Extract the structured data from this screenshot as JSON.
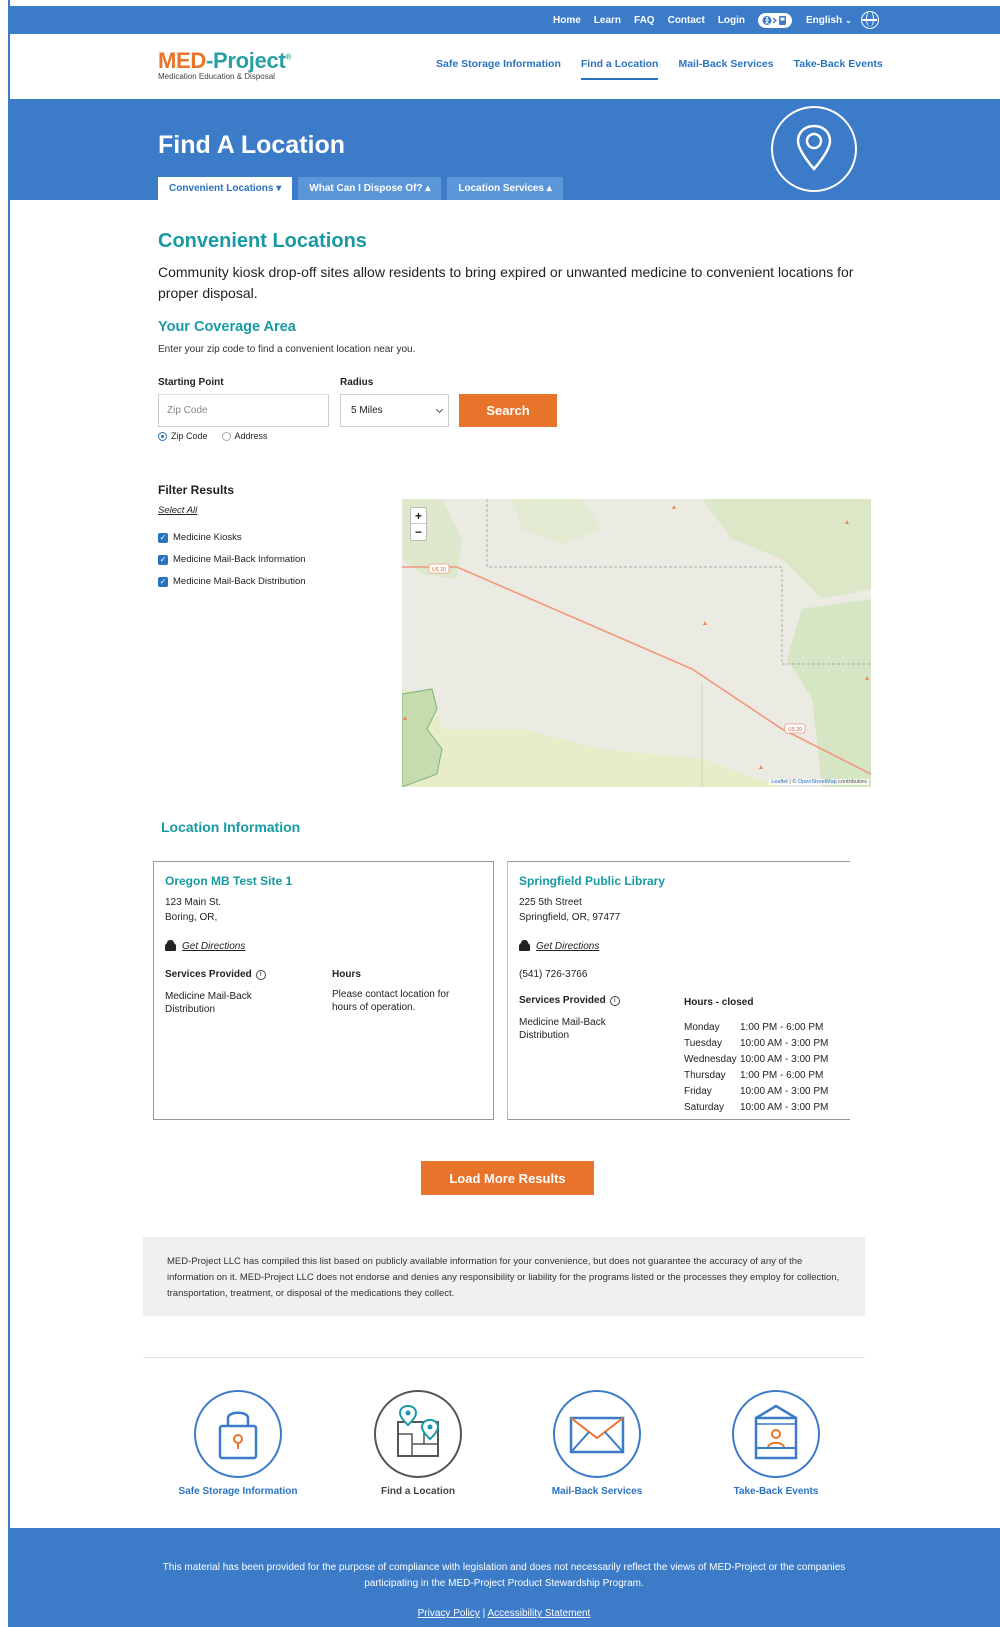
{
  "utility_nav": {
    "items": [
      "Home",
      "Learn",
      "FAQ",
      "Contact",
      "Login"
    ],
    "accessibility_icon": "accessibility-icon",
    "language": "English",
    "globe_icon": "globe-icon"
  },
  "brand": {
    "name_part1": "MED",
    "name_dash": "-",
    "name_part2": "Project",
    "registered": "®",
    "tagline": "Medication Education & Disposal"
  },
  "main_nav": {
    "items": [
      "Safe Storage Information",
      "Find a Location",
      "Mail-Back Services",
      "Take-Back Events"
    ],
    "active": "Find a Location"
  },
  "hero": {
    "title": "Find A Location",
    "tabs": [
      "Convenient Locations ▾",
      "What Can I Dispose Of? ▴",
      "Location Services ▴"
    ]
  },
  "convenient": {
    "title": "Convenient Locations",
    "description": "Community kiosk drop-off sites allow residents to bring expired or unwanted medicine to convenient locations for proper disposal."
  },
  "coverage": {
    "title": "Your Coverage Area",
    "description": "Enter your zip code to find a convenient location near you.",
    "starting_point_label": "Starting Point",
    "radius_label": "Radius",
    "zip_placeholder": "Zip Code",
    "radius_value": "5 Miles",
    "search_label": "Search",
    "radio_zip": "Zip Code",
    "radio_address": "Address",
    "selected_mode": "Zip Code"
  },
  "filters": {
    "title": "Filter Results",
    "select_all": "Select All",
    "options": [
      "Medicine Kiosks",
      "Medicine Mail-Back Information",
      "Medicine Mail-Back Distribution"
    ],
    "checked": [
      true,
      true,
      true
    ]
  },
  "map": {
    "zoom_in": "+",
    "zoom_out": "−",
    "road_label": "US 20",
    "attribution_leaflet": "Leaflet",
    "attribution_sep": " | © ",
    "attribution_osm": "OpenStreetMap",
    "attribution_suffix": " contributors",
    "colors": {
      "land": "#ecebe3",
      "forest": "#d7e6c3",
      "road": "#f2987c",
      "park_border": "#7fb37a"
    }
  },
  "location_info": {
    "title": "Location Information",
    "get_directions": "Get Directions",
    "services_label": "Services Provided",
    "info_icon": "info-icon",
    "car_icon": "car-icon",
    "locations": [
      {
        "name": "Oregon MB Test Site 1",
        "address_line1": "123 Main St.",
        "address_line2": "Boring, OR,",
        "services": "Medicine Mail-Back Distribution",
        "hours_label": "Hours",
        "hours_note": "Please contact location for hours of operation."
      },
      {
        "name": "Springfield Public Library",
        "address_line1": "225 5th Street",
        "address_line2": "Springfield, OR, 97477",
        "phone": "(541) 726-3766",
        "services": "Medicine Mail-Back Distribution",
        "hours_label": "Hours - closed",
        "hours": [
          {
            "day": "Monday",
            "time": "1:00 PM - 6:00 PM"
          },
          {
            "day": "Tuesday",
            "time": "10:00 AM - 3:00 PM"
          },
          {
            "day": "Wednesday",
            "time": "10:00 AM - 3:00 PM"
          },
          {
            "day": "Thursday",
            "time": "1:00 PM - 6:00 PM"
          },
          {
            "day": "Friday",
            "time": "10:00 AM - 3:00 PM"
          },
          {
            "day": "Saturday",
            "time": "10:00 AM - 3:00 PM"
          }
        ]
      }
    ]
  },
  "load_more": "Load More Results",
  "disclaimer": "MED-Project LLC has compiled this list based on publicly available information for your convenience, but does not guarantee the accuracy of any of the information on it. MED-Project LLC does not endorse and denies any responsibility or liability for the programs listed or the processes they employ for collection, transportation, treatment, or disposal of the medications they collect.",
  "features": [
    {
      "label": "Safe Storage Information",
      "icon": "lock-bag-icon"
    },
    {
      "label": "Find a Location",
      "icon": "map-pin-icon"
    },
    {
      "label": "Mail-Back Services",
      "icon": "envelope-icon"
    },
    {
      "label": "Take-Back Events",
      "icon": "event-booth-icon"
    }
  ],
  "footer": {
    "text": "This material has been provided for the purpose of compliance with legislation and does not necessarily reflect the views of MED-Project or the companies participating in the MED-Project Product Stewardship Program.",
    "privacy": "Privacy Policy",
    "separator": "|",
    "accessibility": "Accessibility Statement"
  },
  "colors": {
    "brand_blue": "#3b7bc8",
    "teal": "#179aa3",
    "orange": "#e8742c",
    "link_blue": "#2a73c0"
  }
}
